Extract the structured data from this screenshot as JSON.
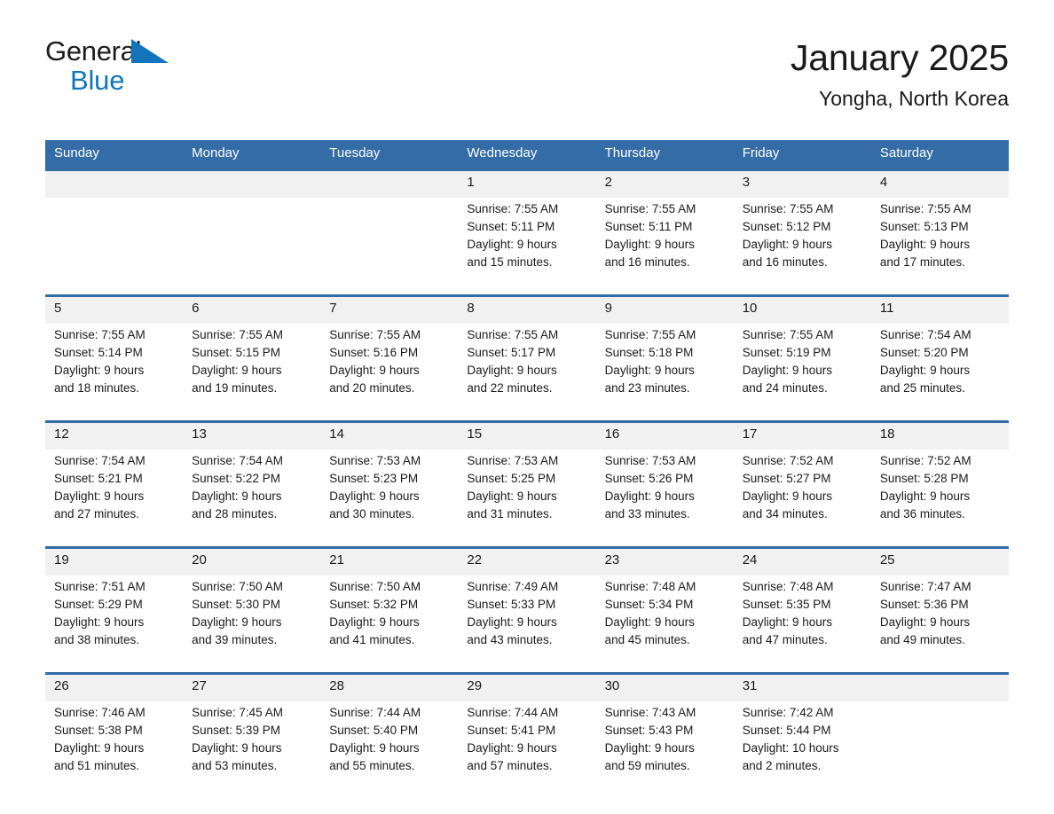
{
  "brand": {
    "name_primary": "General",
    "name_secondary": "Blue",
    "accent_color": "#1275bb"
  },
  "header": {
    "month_title": "January 2025",
    "location": "Yongha, North Korea",
    "header_bg_color": "#336ca6",
    "daynum_bg_color": "#f1f1f1"
  },
  "weekdays": [
    "Sunday",
    "Monday",
    "Tuesday",
    "Wednesday",
    "Thursday",
    "Friday",
    "Saturday"
  ],
  "weeks": [
    {
      "days": [
        {
          "num": "",
          "lines": []
        },
        {
          "num": "",
          "lines": []
        },
        {
          "num": "",
          "lines": []
        },
        {
          "num": "1",
          "lines": [
            "Sunrise: 7:55 AM",
            "Sunset: 5:11 PM",
            "Daylight: 9 hours",
            "and 15 minutes."
          ]
        },
        {
          "num": "2",
          "lines": [
            "Sunrise: 7:55 AM",
            "Sunset: 5:11 PM",
            "Daylight: 9 hours",
            "and 16 minutes."
          ]
        },
        {
          "num": "3",
          "lines": [
            "Sunrise: 7:55 AM",
            "Sunset: 5:12 PM",
            "Daylight: 9 hours",
            "and 16 minutes."
          ]
        },
        {
          "num": "4",
          "lines": [
            "Sunrise: 7:55 AM",
            "Sunset: 5:13 PM",
            "Daylight: 9 hours",
            "and 17 minutes."
          ]
        }
      ]
    },
    {
      "days": [
        {
          "num": "5",
          "lines": [
            "Sunrise: 7:55 AM",
            "Sunset: 5:14 PM",
            "Daylight: 9 hours",
            "and 18 minutes."
          ]
        },
        {
          "num": "6",
          "lines": [
            "Sunrise: 7:55 AM",
            "Sunset: 5:15 PM",
            "Daylight: 9 hours",
            "and 19 minutes."
          ]
        },
        {
          "num": "7",
          "lines": [
            "Sunrise: 7:55 AM",
            "Sunset: 5:16 PM",
            "Daylight: 9 hours",
            "and 20 minutes."
          ]
        },
        {
          "num": "8",
          "lines": [
            "Sunrise: 7:55 AM",
            "Sunset: 5:17 PM",
            "Daylight: 9 hours",
            "and 22 minutes."
          ]
        },
        {
          "num": "9",
          "lines": [
            "Sunrise: 7:55 AM",
            "Sunset: 5:18 PM",
            "Daylight: 9 hours",
            "and 23 minutes."
          ]
        },
        {
          "num": "10",
          "lines": [
            "Sunrise: 7:55 AM",
            "Sunset: 5:19 PM",
            "Daylight: 9 hours",
            "and 24 minutes."
          ]
        },
        {
          "num": "11",
          "lines": [
            "Sunrise: 7:54 AM",
            "Sunset: 5:20 PM",
            "Daylight: 9 hours",
            "and 25 minutes."
          ]
        }
      ]
    },
    {
      "days": [
        {
          "num": "12",
          "lines": [
            "Sunrise: 7:54 AM",
            "Sunset: 5:21 PM",
            "Daylight: 9 hours",
            "and 27 minutes."
          ]
        },
        {
          "num": "13",
          "lines": [
            "Sunrise: 7:54 AM",
            "Sunset: 5:22 PM",
            "Daylight: 9 hours",
            "and 28 minutes."
          ]
        },
        {
          "num": "14",
          "lines": [
            "Sunrise: 7:53 AM",
            "Sunset: 5:23 PM",
            "Daylight: 9 hours",
            "and 30 minutes."
          ]
        },
        {
          "num": "15",
          "lines": [
            "Sunrise: 7:53 AM",
            "Sunset: 5:25 PM",
            "Daylight: 9 hours",
            "and 31 minutes."
          ]
        },
        {
          "num": "16",
          "lines": [
            "Sunrise: 7:53 AM",
            "Sunset: 5:26 PM",
            "Daylight: 9 hours",
            "and 33 minutes."
          ]
        },
        {
          "num": "17",
          "lines": [
            "Sunrise: 7:52 AM",
            "Sunset: 5:27 PM",
            "Daylight: 9 hours",
            "and 34 minutes."
          ]
        },
        {
          "num": "18",
          "lines": [
            "Sunrise: 7:52 AM",
            "Sunset: 5:28 PM",
            "Daylight: 9 hours",
            "and 36 minutes."
          ]
        }
      ]
    },
    {
      "days": [
        {
          "num": "19",
          "lines": [
            "Sunrise: 7:51 AM",
            "Sunset: 5:29 PM",
            "Daylight: 9 hours",
            "and 38 minutes."
          ]
        },
        {
          "num": "20",
          "lines": [
            "Sunrise: 7:50 AM",
            "Sunset: 5:30 PM",
            "Daylight: 9 hours",
            "and 39 minutes."
          ]
        },
        {
          "num": "21",
          "lines": [
            "Sunrise: 7:50 AM",
            "Sunset: 5:32 PM",
            "Daylight: 9 hours",
            "and 41 minutes."
          ]
        },
        {
          "num": "22",
          "lines": [
            "Sunrise: 7:49 AM",
            "Sunset: 5:33 PM",
            "Daylight: 9 hours",
            "and 43 minutes."
          ]
        },
        {
          "num": "23",
          "lines": [
            "Sunrise: 7:48 AM",
            "Sunset: 5:34 PM",
            "Daylight: 9 hours",
            "and 45 minutes."
          ]
        },
        {
          "num": "24",
          "lines": [
            "Sunrise: 7:48 AM",
            "Sunset: 5:35 PM",
            "Daylight: 9 hours",
            "and 47 minutes."
          ]
        },
        {
          "num": "25",
          "lines": [
            "Sunrise: 7:47 AM",
            "Sunset: 5:36 PM",
            "Daylight: 9 hours",
            "and 49 minutes."
          ]
        }
      ]
    },
    {
      "days": [
        {
          "num": "26",
          "lines": [
            "Sunrise: 7:46 AM",
            "Sunset: 5:38 PM",
            "Daylight: 9 hours",
            "and 51 minutes."
          ]
        },
        {
          "num": "27",
          "lines": [
            "Sunrise: 7:45 AM",
            "Sunset: 5:39 PM",
            "Daylight: 9 hours",
            "and 53 minutes."
          ]
        },
        {
          "num": "28",
          "lines": [
            "Sunrise: 7:44 AM",
            "Sunset: 5:40 PM",
            "Daylight: 9 hours",
            "and 55 minutes."
          ]
        },
        {
          "num": "29",
          "lines": [
            "Sunrise: 7:44 AM",
            "Sunset: 5:41 PM",
            "Daylight: 9 hours",
            "and 57 minutes."
          ]
        },
        {
          "num": "30",
          "lines": [
            "Sunrise: 7:43 AM",
            "Sunset: 5:43 PM",
            "Daylight: 9 hours",
            "and 59 minutes."
          ]
        },
        {
          "num": "31",
          "lines": [
            "Sunrise: 7:42 AM",
            "Sunset: 5:44 PM",
            "Daylight: 10 hours",
            "and 2 minutes."
          ]
        },
        {
          "num": "",
          "lines": []
        }
      ]
    }
  ]
}
